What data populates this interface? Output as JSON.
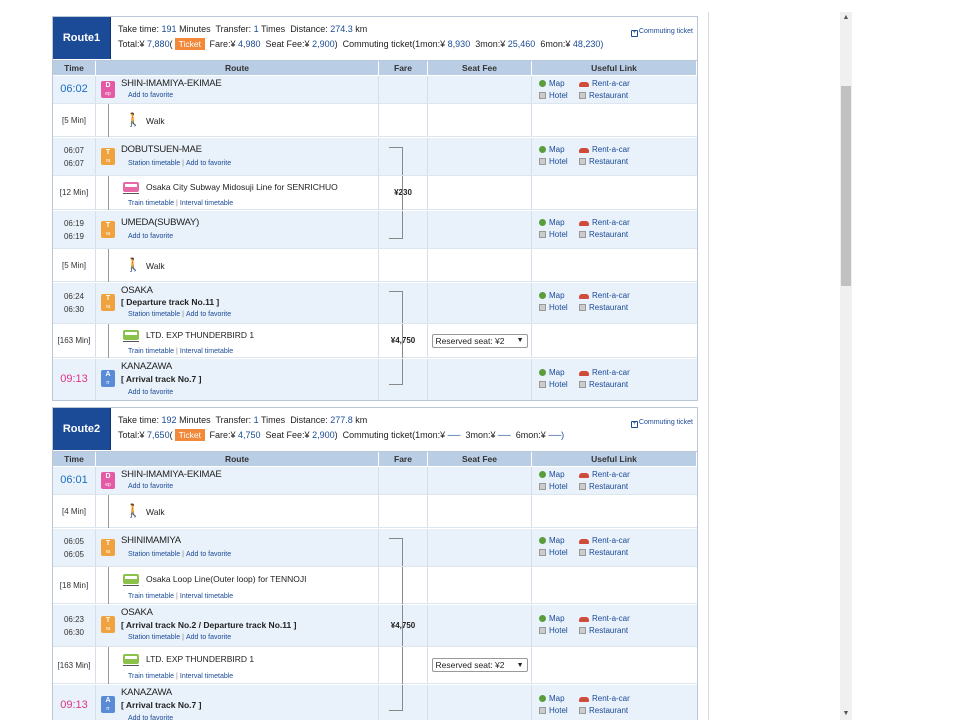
{
  "labels": {
    "take_time": "Take time:",
    "minutes": "Minutes",
    "transfer": "Transfer:",
    "times": "Times",
    "distance": "Distance:",
    "km": "km",
    "total": "Total:¥",
    "ticket": "Ticket",
    "fare": "Fare:¥",
    "seat_fee": "Seat Fee:¥",
    "commuting": "Commuting ticket(1mon:¥",
    "three_mon": "3mon:¥",
    "six_mon": "6mon:¥",
    "commuting_link": "Commuting ticket",
    "map": "Map",
    "rent": "Rent-a-car",
    "hotel": "Hotel",
    "restaurant": "Restaurant",
    "add_fav": "Add to favorite",
    "station_tt": "Station timetable",
    "train_tt": "Train timetable",
    "interval_tt": "Interval timetable",
    "walk": "Walk"
  },
  "columns": [
    "Time",
    "Route",
    "Fare",
    "Seat Fee",
    "Useful Link"
  ],
  "route1": {
    "name": "Route1",
    "take_time": "191",
    "transfer": "1",
    "distance": "274.3",
    "total": "7,880",
    "fare": "4,980",
    "seat_fee": "2,900",
    "c1": "8,930",
    "c3": "25,460",
    "c6": "48,230)",
    "rows": {
      "s1_time": "06:02",
      "s1_name": "SHIN-IMAMIYA-EKIMAE",
      "s1_icon": "D",
      "s1_icon_sub": "ep",
      "w1_dur": "[5 Min]",
      "s2_arr": "06:07",
      "s2_dep": "06:07",
      "s2_name": "DOBUTSUEN-MAE",
      "s2_icon": "T",
      "s2_icon_sub": "ra",
      "l1_dur": "[12 Min]",
      "l1_name": "Osaka City Subway Midosuji Line  for SENRICHUO",
      "l1_fare": "¥230",
      "s3_arr": "06:19",
      "s3_dep": "06:19",
      "s3_name": "UMEDA(SUBWAY)",
      "s3_icon": "T",
      "s3_icon_sub": "ra",
      "w2_dur": "[5 Min]",
      "s4_arr": "06:24",
      "s4_dep": "06:30",
      "s4_name": "OSAKA",
      "s4_track": "[ Departure track No.11 ]",
      "s4_icon": "T",
      "s4_icon_sub": "ra",
      "l2_dur": "[163 Min]",
      "l2_name": "LTD. EXP THUNDERBIRD 1",
      "l2_fare": "¥4,750",
      "l2_seat": "Reserved seat: ¥2",
      "s5_time": "09:13",
      "s5_name": "KANAZAWA",
      "s5_track": "[ Arrival track No.7 ]",
      "s5_icon": "A",
      "s5_icon_sub": "rr"
    }
  },
  "route2": {
    "name": "Route2",
    "take_time": "192",
    "transfer": "1",
    "distance": "277.8",
    "total": "7,650",
    "fare": "4,750",
    "seat_fee": "2,900",
    "c1": "──",
    "c3": "──",
    "c6": "──)",
    "rows": {
      "s1_time": "06:01",
      "s1_name": "SHIN-IMAMIYA-EKIMAE",
      "s1_icon": "D",
      "s1_icon_sub": "ep",
      "w1_dur": "[4 Min]",
      "s2_arr": "06:05",
      "s2_dep": "06:05",
      "s2_name": "SHINIMAMIYA",
      "s2_icon": "T",
      "s2_icon_sub": "ra",
      "l1_dur": "[18 Min]",
      "l1_name": "Osaka Loop Line(Outer loop)  for TENNOJI",
      "s3_arr": "06:23",
      "s3_dep": "06:30",
      "s3_name": "OSAKA",
      "s3_track": "[ Arrival track No.2 / Departure track No.11 ]",
      "s3_fare": "¥4,750",
      "s3_icon": "T",
      "s3_icon_sub": "ra",
      "l2_dur": "[163 Min]",
      "l2_name": "LTD. EXP THUNDERBIRD 1",
      "l2_seat": "Reserved seat: ¥2",
      "s4_time": "09:13",
      "s4_name": "KANAZAWA",
      "s4_track": "[ Arrival track No.7 ]",
      "s4_icon": "A",
      "s4_icon_sub": "rr"
    }
  },
  "scroll": {
    "up": "▲",
    "down": "▼"
  }
}
